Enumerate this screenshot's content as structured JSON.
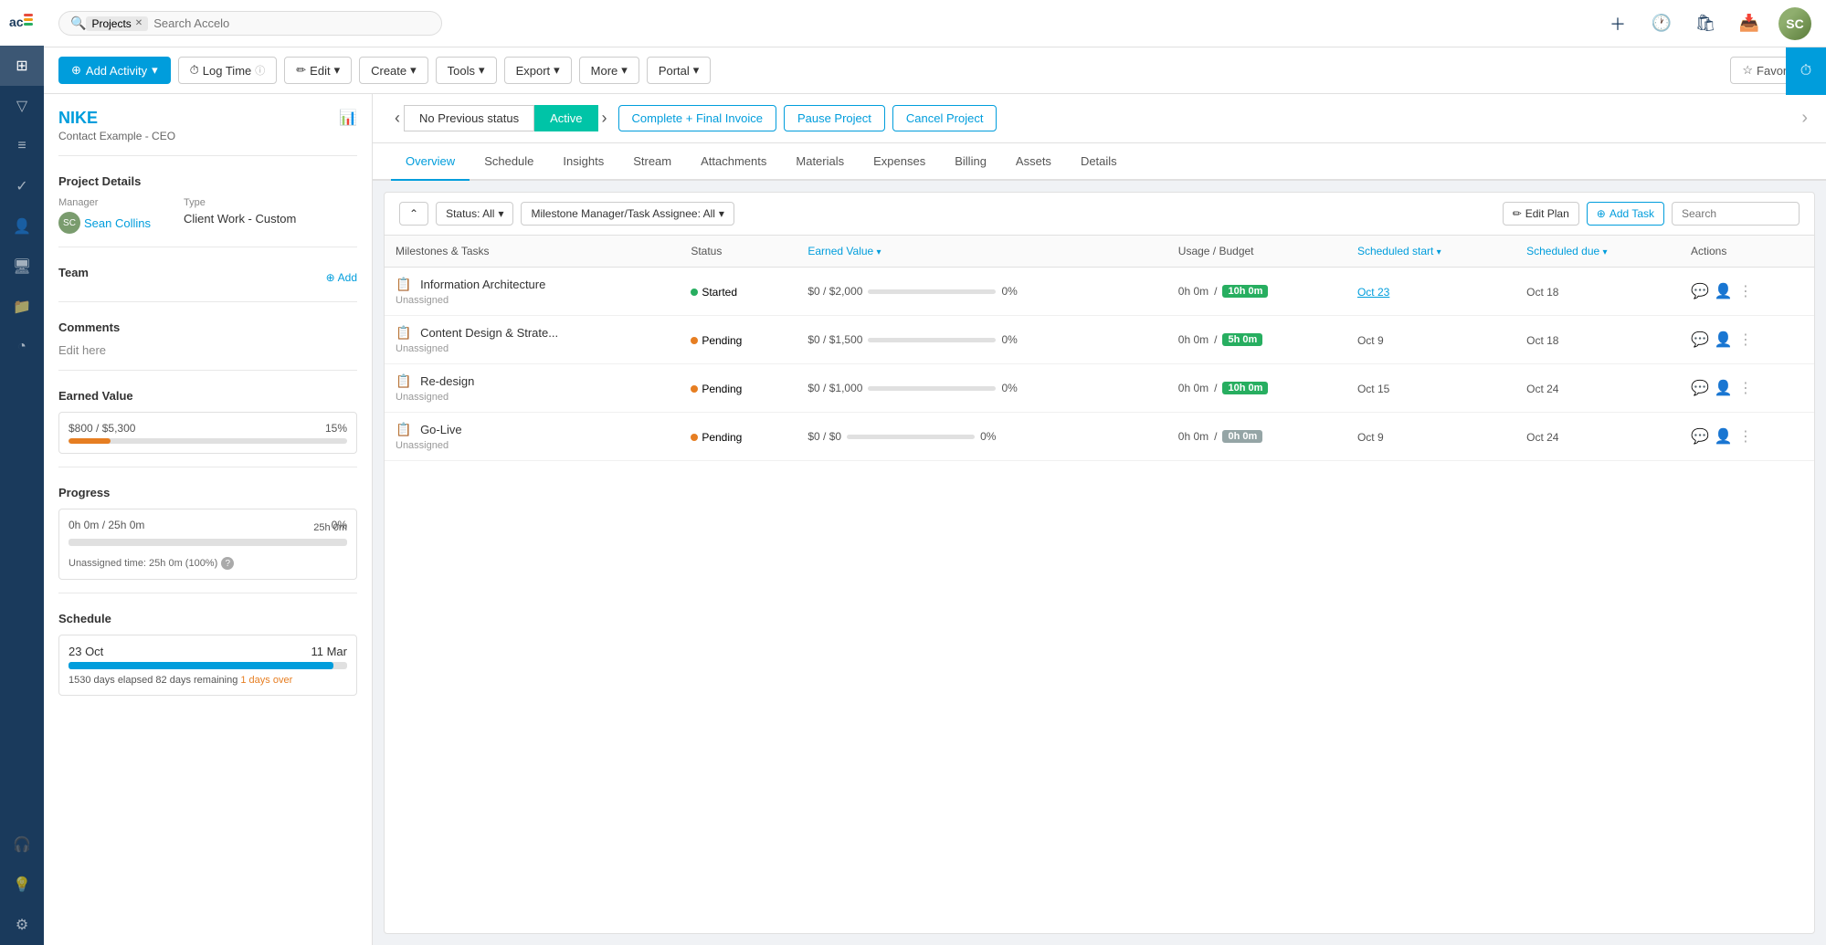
{
  "app": {
    "name": "accelo",
    "search_placeholder": "Search Accelo",
    "search_tag": "Projects"
  },
  "topnav": {
    "icons": [
      "plus",
      "clock",
      "bag",
      "inbox"
    ],
    "avatar_initials": "SC"
  },
  "action_bar": {
    "add_activity_label": "Add Activity",
    "log_time_label": "Log Time",
    "edit_label": "Edit",
    "create_label": "Create",
    "tools_label": "Tools",
    "export_label": "Export",
    "more_label": "More",
    "portal_label": "Portal",
    "favorite_label": "Favorite"
  },
  "left_panel": {
    "company_name": "NIKE",
    "company_subtitle": "Contact Example - CEO",
    "project_details_title": "Project Details",
    "manager_label": "Manager",
    "type_label": "Type",
    "manager_name": "Sean Collins",
    "manager_initials": "SC",
    "project_type": "Client Work - Custom",
    "team_title": "Team",
    "add_label": "Add",
    "comments_title": "Comments",
    "comment_placeholder": "Edit here",
    "earned_value_title": "Earned Value",
    "ev_current": "$800",
    "ev_total": "$5,300",
    "ev_pct": "15%",
    "progress_title": "Progress",
    "prog_current": "0h 0m",
    "prog_total": "25h 0m",
    "prog_pct": "0%",
    "prog_bar_label": "25h 0m",
    "unassigned_note": "Unassigned time: 25h 0m (100%)",
    "schedule_title": "Schedule",
    "schedule_start": "23 Oct",
    "schedule_end": "11 Mar",
    "schedule_note": "1530 days elapsed",
    "schedule_remaining": "82 days remaining",
    "schedule_overdue": "1 days over"
  },
  "status_bar": {
    "prev_label": "◀",
    "next_label": "▶",
    "no_prev_status": "No Previous status",
    "active_label": "Active",
    "complete_label": "Complete + Final Invoice",
    "pause_label": "Pause Project",
    "cancel_label": "Cancel Project"
  },
  "tabs": [
    {
      "id": "overview",
      "label": "Overview",
      "active": true
    },
    {
      "id": "schedule",
      "label": "Schedule",
      "active": false
    },
    {
      "id": "insights",
      "label": "Insights",
      "active": false
    },
    {
      "id": "stream",
      "label": "Stream",
      "active": false
    },
    {
      "id": "attachments",
      "label": "Attachments",
      "active": false
    },
    {
      "id": "materials",
      "label": "Materials",
      "active": false
    },
    {
      "id": "expenses",
      "label": "Expenses",
      "active": false
    },
    {
      "id": "billing",
      "label": "Billing",
      "active": false
    },
    {
      "id": "assets",
      "label": "Assets",
      "active": false
    },
    {
      "id": "details",
      "label": "Details",
      "active": false
    }
  ],
  "filter_bar": {
    "collapse_label": "⌃",
    "status_filter": "Status: All",
    "milestone_filter": "Milestone Manager/Task Assignee: All",
    "edit_plan_label": "Edit Plan",
    "add_task_label": "Add Task",
    "search_placeholder": "Search"
  },
  "table": {
    "columns": [
      {
        "id": "milestones",
        "label": "Milestones & Tasks"
      },
      {
        "id": "status",
        "label": "Status"
      },
      {
        "id": "earned_value",
        "label": "Earned Value",
        "sortable": true
      },
      {
        "id": "usage_budget",
        "label": "Usage / Budget"
      },
      {
        "id": "scheduled_start",
        "label": "Scheduled start",
        "sortable": true
      },
      {
        "id": "scheduled_due",
        "label": "Scheduled due",
        "sortable": true
      },
      {
        "id": "actions",
        "label": "Actions"
      }
    ],
    "rows": [
      {
        "name": "Information Architecture",
        "sub": "Unassigned",
        "status": "Started",
        "status_color": "green",
        "ev_value": "$0 / $2,000",
        "ev_pct": 0,
        "usage_time": "0h 0m",
        "budget_tag": "10h 0m",
        "budget_tag_color": "green",
        "start": "Oct 23",
        "start_link": true,
        "due": "Oct 18",
        "due_link": false
      },
      {
        "name": "Content Design & Strate...",
        "sub": "Unassigned",
        "status": "Pending",
        "status_color": "orange",
        "ev_value": "$0 / $1,500",
        "ev_pct": 0,
        "usage_time": "0h 0m",
        "budget_tag": "5h 0m",
        "budget_tag_color": "green",
        "start": "Oct 9",
        "start_link": false,
        "due": "Oct 18",
        "due_link": false
      },
      {
        "name": "Re-design",
        "sub": "Unassigned",
        "status": "Pending",
        "status_color": "orange",
        "ev_value": "$0 / $1,000",
        "ev_pct": 0,
        "usage_time": "0h 0m",
        "budget_tag": "10h 0m",
        "budget_tag_color": "green",
        "start": "Oct 15",
        "start_link": false,
        "due": "Oct 24",
        "due_link": false
      },
      {
        "name": "Go-Live",
        "sub": "Unassigned",
        "status": "Pending",
        "status_color": "orange",
        "ev_value": "$0 / $0",
        "ev_pct": 0,
        "usage_time": "0h 0m",
        "budget_tag": "0h 0m",
        "budget_tag_color": "gray",
        "start": "Oct 9",
        "start_link": false,
        "due": "Oct 24",
        "due_link": false
      }
    ]
  }
}
